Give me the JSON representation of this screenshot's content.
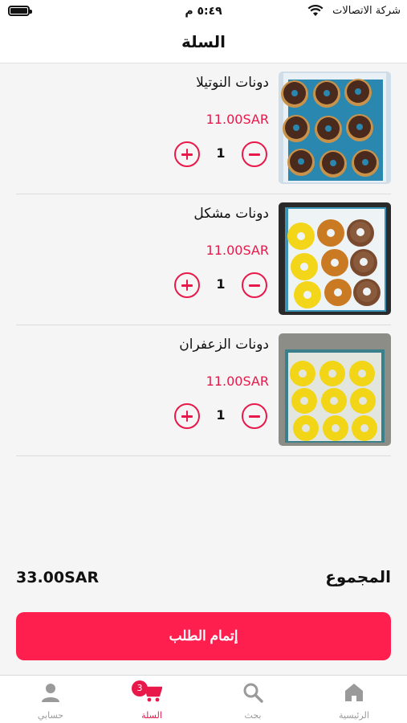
{
  "status": {
    "time": "٥:٤٩ م",
    "carrier": "شركة الاتصالات"
  },
  "header": {
    "title": "السلة"
  },
  "items": [
    {
      "name": "دونات النوتيلا",
      "price": "11.00SAR",
      "qty": "1",
      "image": "nutella-donuts-box"
    },
    {
      "name": "دونات مشكل",
      "price": "11.00SAR",
      "qty": "1",
      "image": "mixed-donuts-box"
    },
    {
      "name": "دونات الزعفران",
      "price": "11.00SAR",
      "qty": "1",
      "image": "saffron-donuts-box"
    }
  ],
  "summary": {
    "total_label": "المجموع",
    "total_value": "33.00SAR"
  },
  "checkout": {
    "label": "إتمام الطلب"
  },
  "tabbar": {
    "tabs": [
      {
        "label": "الرئيسية",
        "icon": "home-icon"
      },
      {
        "label": "بحث",
        "icon": "search-icon"
      },
      {
        "label": "السلة",
        "icon": "cart-icon",
        "badge": "3",
        "active": true
      },
      {
        "label": "حسابي",
        "icon": "user-icon"
      }
    ]
  },
  "colors": {
    "accent": "#e8194a",
    "button": "#ff1f4f",
    "background": "#f5f5f5"
  }
}
